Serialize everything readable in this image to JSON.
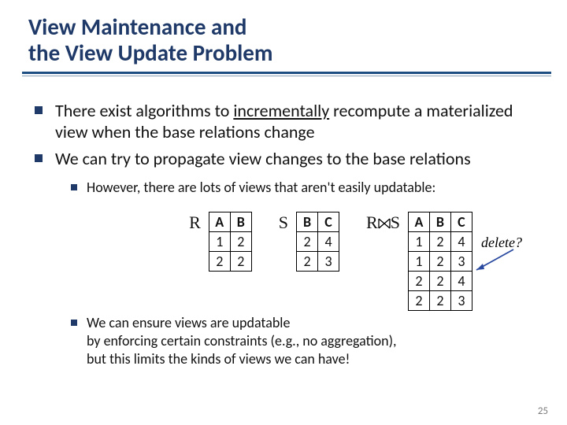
{
  "title": {
    "line1": "View Maintenance and",
    "line2": "the View Update Problem"
  },
  "bullets": {
    "b1_pre": "There exist algorithms to ",
    "b1_u": "incrementally",
    "b1_post": " recompute a materialized view when the base relations change",
    "b2": "We can try to propagate view changes to the base relations",
    "b2_sub1": "However, there are lots of views that aren't easily updatable:",
    "b2_sub2a": "We can ensure views are updatable",
    "b2_sub2b": "by enforcing certain constraints (e.g., no aggregation),",
    "b2_sub2c": "but this limits the kinds of views we can have!"
  },
  "relations": {
    "R": {
      "name": "R",
      "cols": [
        "A",
        "B"
      ],
      "rows": [
        [
          "1",
          "2"
        ],
        [
          "2",
          "2"
        ]
      ]
    },
    "S": {
      "name": "S",
      "cols": [
        "B",
        "C"
      ],
      "rows": [
        [
          "2",
          "4"
        ],
        [
          "2",
          "3"
        ]
      ]
    },
    "RS": {
      "name_pre": "R",
      "name_post": "S",
      "cols": [
        "A",
        "B",
        "C"
      ],
      "rows": [
        [
          "1",
          "2",
          "4"
        ],
        [
          "1",
          "2",
          "3"
        ],
        [
          "2",
          "2",
          "4"
        ],
        [
          "2",
          "2",
          "3"
        ]
      ]
    }
  },
  "annotation": {
    "delete": "delete?"
  },
  "page": "25",
  "chart_data": [
    {
      "type": "table",
      "title": "R",
      "columns": [
        "A",
        "B"
      ],
      "rows": [
        [
          1,
          2
        ],
        [
          2,
          2
        ]
      ]
    },
    {
      "type": "table",
      "title": "S",
      "columns": [
        "B",
        "C"
      ],
      "rows": [
        [
          2,
          4
        ],
        [
          2,
          3
        ]
      ]
    },
    {
      "type": "table",
      "title": "R⋈S",
      "columns": [
        "A",
        "B",
        "C"
      ],
      "rows": [
        [
          1,
          2,
          4
        ],
        [
          1,
          2,
          3
        ],
        [
          2,
          2,
          4
        ],
        [
          2,
          2,
          3
        ]
      ]
    }
  ]
}
